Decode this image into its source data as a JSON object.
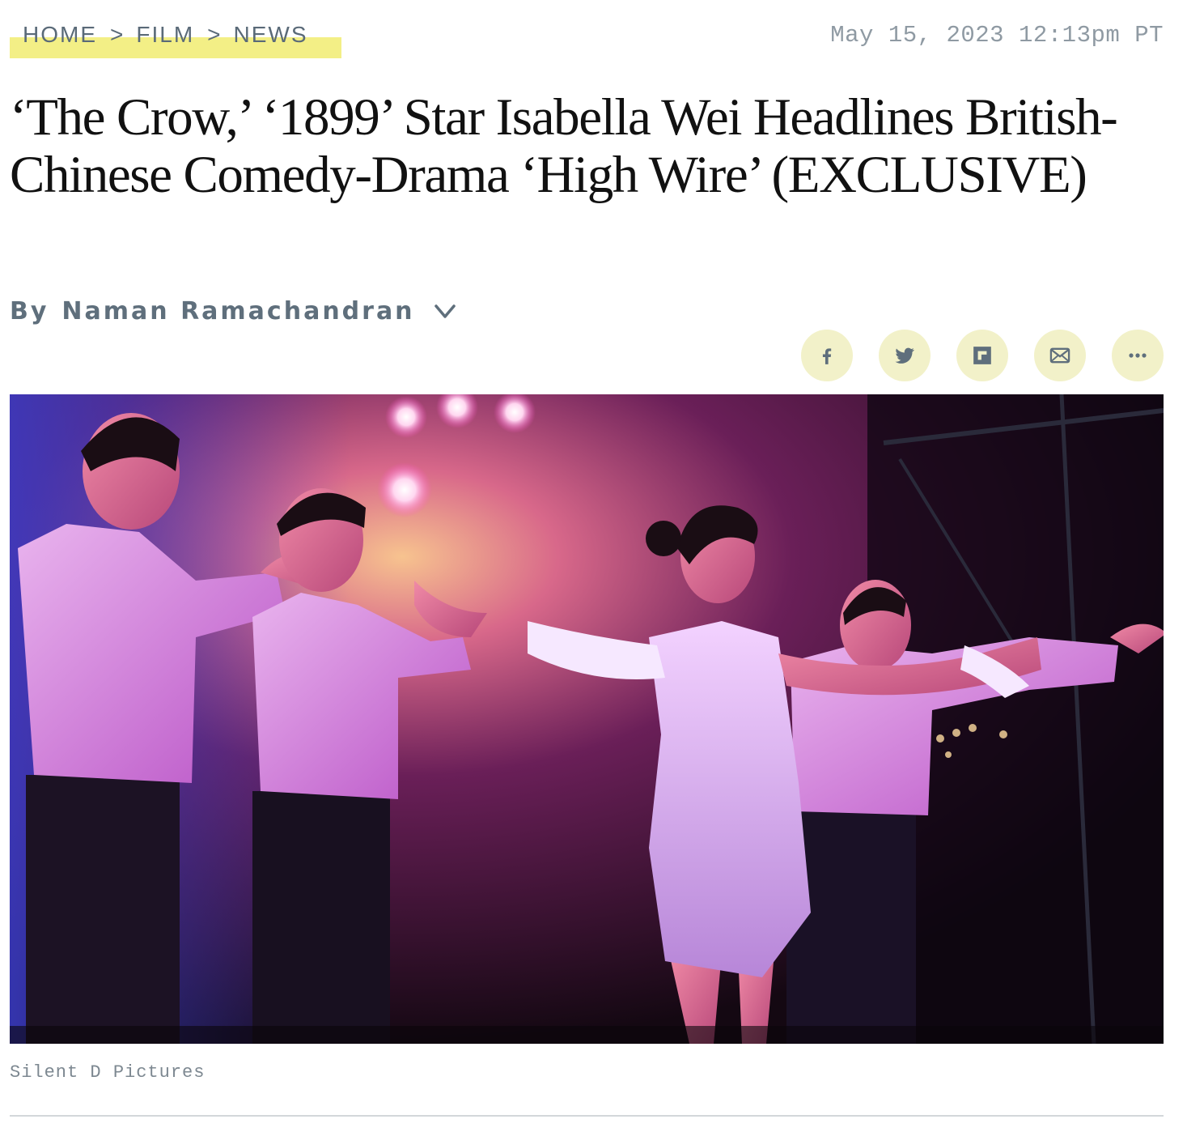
{
  "breadcrumb": {
    "items": [
      "HOME",
      "FILM",
      "NEWS"
    ],
    "separator": ">"
  },
  "date": "May 15, 2023 12:13pm PT",
  "headline": "‘The Crow,’ ‘1899’ Star Isabella Wei Headlines British-Chinese Comedy-Drama ‘High Wire’ (EXCLUSIVE)",
  "byline": {
    "prefix": "By",
    "author": "Naman Ramachandran"
  },
  "share": {
    "icons": [
      "facebook-icon",
      "twitter-icon",
      "flipboard-icon",
      "email-icon",
      "more-icon"
    ]
  },
  "image": {
    "credit": "Silent D Pictures"
  },
  "colors": {
    "breadcrumb_highlight": "#f3ef86",
    "share_button_bg": "#f2f1c9",
    "byline_text": "#5f6f7c",
    "meta_text": "#8f9aa3"
  }
}
